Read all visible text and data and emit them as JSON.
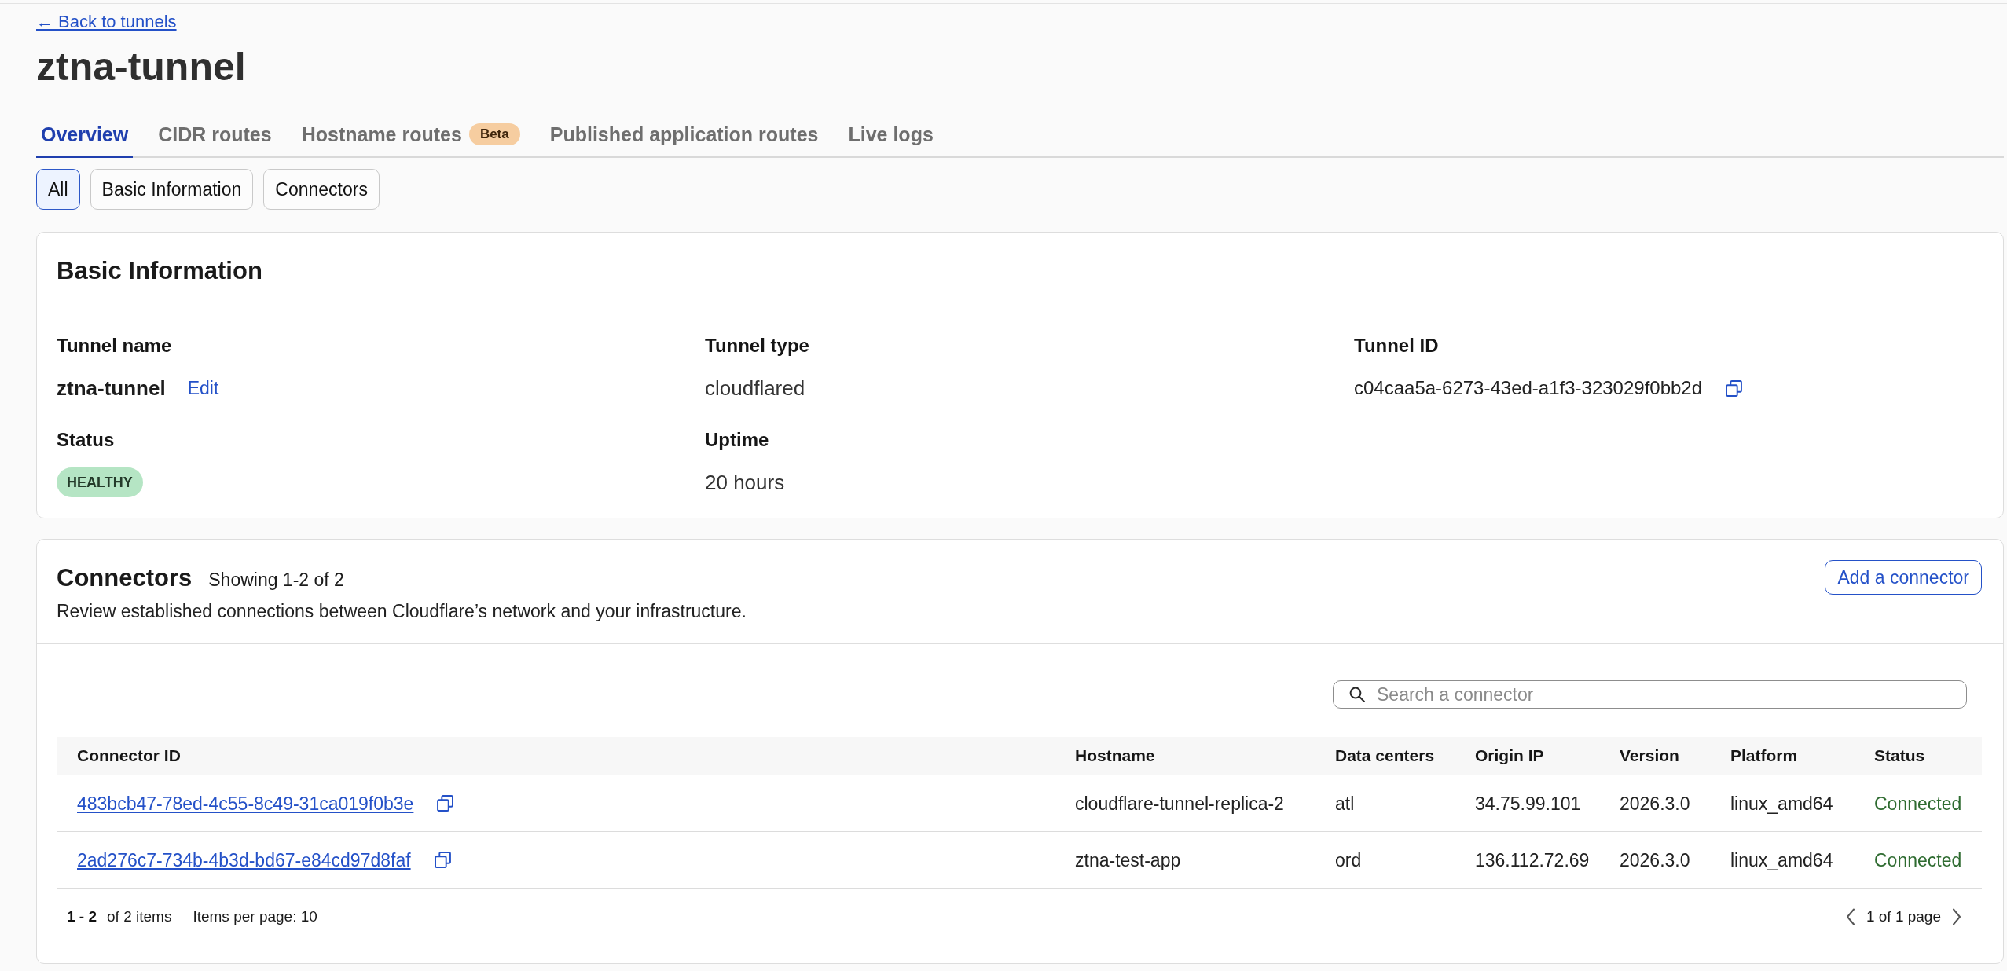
{
  "back_link": "← Back to tunnels",
  "title": "ztna-tunnel",
  "tabs": [
    {
      "label": "Overview",
      "selected": true
    },
    {
      "label": "CIDR routes",
      "selected": false
    },
    {
      "label": "Hostname routes",
      "badge": "Beta",
      "selected": false
    },
    {
      "label": "Published application routes",
      "selected": false
    },
    {
      "label": "Live logs",
      "selected": false
    }
  ],
  "filters": [
    {
      "label": "All",
      "selected": true
    },
    {
      "label": "Basic Information",
      "selected": false
    },
    {
      "label": "Connectors",
      "selected": false
    }
  ],
  "basic_information": {
    "title": "Basic Information",
    "fields": [
      {
        "kind": "editable",
        "label": "Tunnel name",
        "value": "ztna-tunnel",
        "action": "Edit"
      },
      {
        "kind": "text",
        "label": "Tunnel type",
        "value": "cloudflared"
      },
      {
        "kind": "copyable",
        "label": "Tunnel ID",
        "value": "c04caa5a-6273-43ed-a1f3-323029f0bb2d"
      },
      {
        "kind": "badge",
        "label": "Status",
        "value": "HEALTHY"
      },
      {
        "kind": "text",
        "label": "Uptime",
        "value": "20 hours"
      }
    ]
  },
  "connectors": {
    "title": "Connectors",
    "count": "Showing 1-2 of 2",
    "description": "Review established connections between Cloudflare’s network and your infrastructure.",
    "add_button": "Add a connector",
    "search": {
      "placeholder": "Search a connector"
    },
    "table": {
      "columns": [
        {
          "label": "Connector ID",
          "kind": "copy_link"
        },
        {
          "label": "Hostname",
          "kind": "text"
        },
        {
          "label": "Data centers",
          "kind": "text"
        },
        {
          "label": "Origin IP",
          "kind": "text"
        },
        {
          "label": "Version",
          "kind": "text"
        },
        {
          "label": "Platform",
          "kind": "text"
        },
        {
          "label": "Status",
          "kind": "status"
        }
      ],
      "rows": [
        [
          "483bcb47-78ed-4c55-8c49-31ca019f0b3e",
          "cloudflare-tunnel-replica-2",
          "atl",
          "34.75.99.101",
          "2026.3.0",
          "linux_amd64",
          "Connected"
        ],
        [
          "2ad276c7-734b-4b3d-bd67-e84cd97d8faf",
          "ztna-test-app",
          "ord",
          "136.112.72.69",
          "2026.3.0",
          "linux_amd64",
          "Connected"
        ]
      ]
    },
    "pagination": {
      "range": "1 - 2",
      "total": "of 2 items",
      "per_page": "Items per page: 10",
      "page": "1 of 1 page"
    }
  }
}
